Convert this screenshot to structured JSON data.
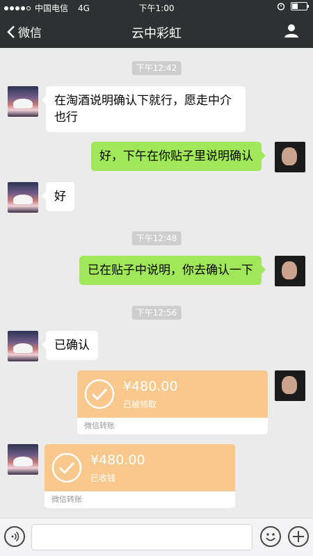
{
  "status": {
    "carrier": "中国电信",
    "network": "4G",
    "time": "下午1:00"
  },
  "nav": {
    "back_label": "微信",
    "title": "云中彩虹"
  },
  "chat": {
    "times": [
      "下午12:42",
      "下午12:48",
      "下午12:56"
    ],
    "messages": [
      "在淘酒说明确认下就行，愿走中介也行",
      "好，下午在你贴子里说明确认",
      "好",
      "已在贴子中说明，你去确认一下",
      "已确认"
    ],
    "transfers": [
      {
        "amount": "¥480.00",
        "status": "已被领取",
        "label": "微信转账"
      },
      {
        "amount": "¥480.00",
        "status": "已收钱",
        "label": "微信转账"
      }
    ]
  },
  "colors": {
    "bar": "#2e3132",
    "chat_bg": "#ebebeb",
    "out_bubble": "#a0e75a",
    "transfer": "#f9c88d"
  }
}
